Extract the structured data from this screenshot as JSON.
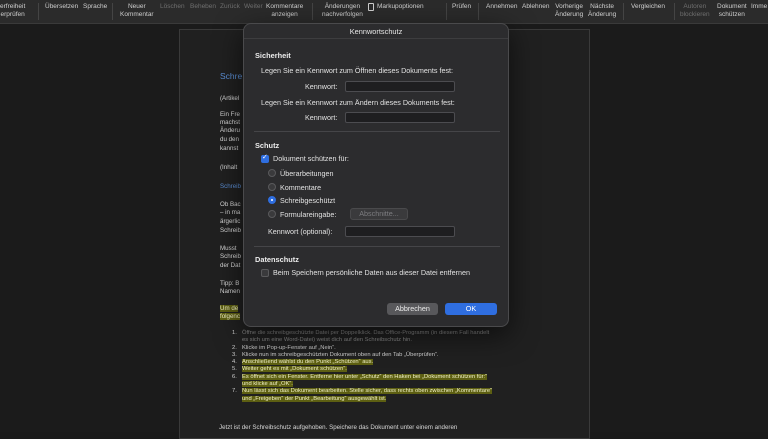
{
  "ribbon": {
    "items": [
      {
        "label": "erfreiheit\nerprüfen",
        "enabled": true
      },
      {
        "label": "Übersetzen",
        "enabled": true
      },
      {
        "label": "Sprache",
        "enabled": true
      },
      {
        "label": "Neuer\nKommentar",
        "enabled": true
      },
      {
        "label": "Löschen",
        "enabled": false
      },
      {
        "label": "Beheben",
        "enabled": false
      },
      {
        "label": "Zurück",
        "enabled": false
      },
      {
        "label": "Weiter",
        "enabled": false
      },
      {
        "label": "Kommentare\nanzeigen",
        "enabled": true
      },
      {
        "label": "Änderungen\nnachverfolgen",
        "enabled": true
      },
      {
        "label": "Markupoptionen",
        "enabled": true
      },
      {
        "label": "Prüfen",
        "enabled": true
      },
      {
        "label": "Annehmen",
        "enabled": true
      },
      {
        "label": "Ablehnen",
        "enabled": true
      },
      {
        "label": "Vorherige\nÄnderung",
        "enabled": true
      },
      {
        "label": "Nächste\nÄnderung",
        "enabled": true
      },
      {
        "label": "Vergleichen",
        "enabled": true
      },
      {
        "label": "Autoren\nblockieren",
        "enabled": false
      },
      {
        "label": "Dokument\nschützen",
        "enabled": true
      },
      {
        "label": "Imme",
        "enabled": true
      }
    ]
  },
  "document": {
    "heading": "Schre",
    "lines": [
      "(Artikel",
      "Ein Fre",
      "machst",
      "Änderu",
      "du den",
      "kannst",
      "(Inhalt",
      "Schreib",
      "Ob Bac",
      "– in ma",
      "ärgerlic",
      "Schreib",
      "Musst",
      "Schreib",
      "der Dat",
      "Tipp: B",
      "Namen",
      "Um de",
      "folgenc"
    ],
    "steps": [
      {
        "num": "1.",
        "text": "Öffne die schreibgeschützte Datei per Doppelklick. Das Office-Programm (in diesem Fall handelt es sich um eine Word-Datei) weist dich auf den Schreibschutz hin.",
        "highlight": false,
        "dimmed": true
      },
      {
        "num": "2.",
        "text": "Klicke im Pop-up-Fenster auf „Nein“.",
        "highlight": false,
        "dimmed": false
      },
      {
        "num": "3.",
        "text": "Klicke nun im schreibgeschützten Dokument oben auf den Tab „Überprüfen“.",
        "highlight": false,
        "dimmed": false
      },
      {
        "num": "4.",
        "text": "Anschließend wählst du den Punkt „Schützen“ aus.",
        "highlight": true,
        "dimmed": false
      },
      {
        "num": "5.",
        "text": "Weiter geht es mit „Dokument schützen“.",
        "highlight": true,
        "dimmed": false
      },
      {
        "num": "6.",
        "text": "Es öffnet sich ein Fenster. Entferne hier unter „Schutz“ den Haken bei „Dokument schützen für:“ und klicke auf „OK“.",
        "highlight": true,
        "dimmed": false
      },
      {
        "num": "7.",
        "text": "Nun lässt sich das Dokument bearbeiten. Stelle sicher, dass rechts oben zwischen „Kommentare“ und „Freigeben“ der Punkt „Bearbeitung“ ausgewählt ist.",
        "highlight": true,
        "dimmed": false
      }
    ],
    "cutoff_line": "Jetzt ist der Schreibschutz aufgehoben. Speichere das Dokument unter einem anderen"
  },
  "dialog": {
    "title": "Kennwortschutz",
    "security": {
      "heading": "Sicherheit",
      "open_prompt": "Legen Sie ein Kennwort zum Öffnen dieses Dokuments fest:",
      "open_label": "Kennwort:",
      "open_value": "",
      "modify_prompt": "Legen Sie ein Kennwort zum Ändern dieses Dokuments fest:",
      "modify_label": "Kennwort:",
      "modify_value": ""
    },
    "protection": {
      "heading": "Schutz",
      "protect_label": "Dokument schützen für:",
      "protect_checked": true,
      "options": [
        {
          "label": "Überarbeitungen",
          "selected": false
        },
        {
          "label": "Kommentare",
          "selected": false
        },
        {
          "label": "Schreibgeschützt",
          "selected": true
        },
        {
          "label": "Formulareingabe:",
          "selected": false
        }
      ],
      "sections_button": "Abschnitte...",
      "optional_password_label": "Kennwort (optional):",
      "optional_password_value": ""
    },
    "privacy": {
      "heading": "Datenschutz",
      "remove_personal_label": "Beim Speichern persönliche Daten aus dieser Datei entfernen",
      "remove_personal_checked": false
    },
    "buttons": {
      "cancel": "Abbrechen",
      "ok": "OK"
    }
  },
  "colors": {
    "accent": "#2f6ee0",
    "highlight": "#5d5f12",
    "heading_blue": "#5b8fd6"
  },
  "icons": [
    "markup-options-icon"
  ]
}
